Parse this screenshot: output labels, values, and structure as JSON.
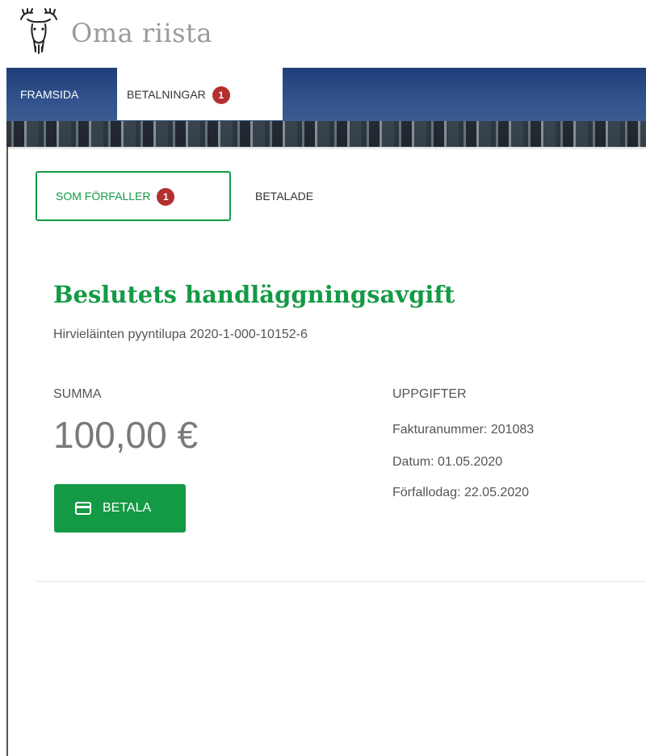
{
  "header": {
    "brand": "Oma riista",
    "logo_icon": "moose-head-icon"
  },
  "nav": {
    "items": [
      {
        "label": "FRAMSIDA"
      },
      {
        "label": "BETALNINGAR",
        "badge": "1",
        "active": true
      }
    ]
  },
  "tabs": {
    "due": {
      "label": "SOM FÖRFALLER",
      "badge": "1"
    },
    "paid": {
      "label": "BETALADE"
    }
  },
  "invoice": {
    "title": "Beslutets handläggningsavgift",
    "subtitle": "Hirvieläinten pyyntilupa 2020-1-000-10152-6",
    "sum_label": "SUMMA",
    "amount": "100,00 €",
    "pay_button": "BETALA",
    "pay_icon": "credit-card-icon",
    "details_label": "UPPGIFTER",
    "details": [
      "Fakturanummer: 201083",
      "Datum: 01.05.2020",
      "Förfallodag: 22.05.2020"
    ]
  },
  "colors": {
    "accent_green": "#149a45",
    "badge_red": "#b3302f",
    "nav_blue": "#2d4f8c"
  }
}
